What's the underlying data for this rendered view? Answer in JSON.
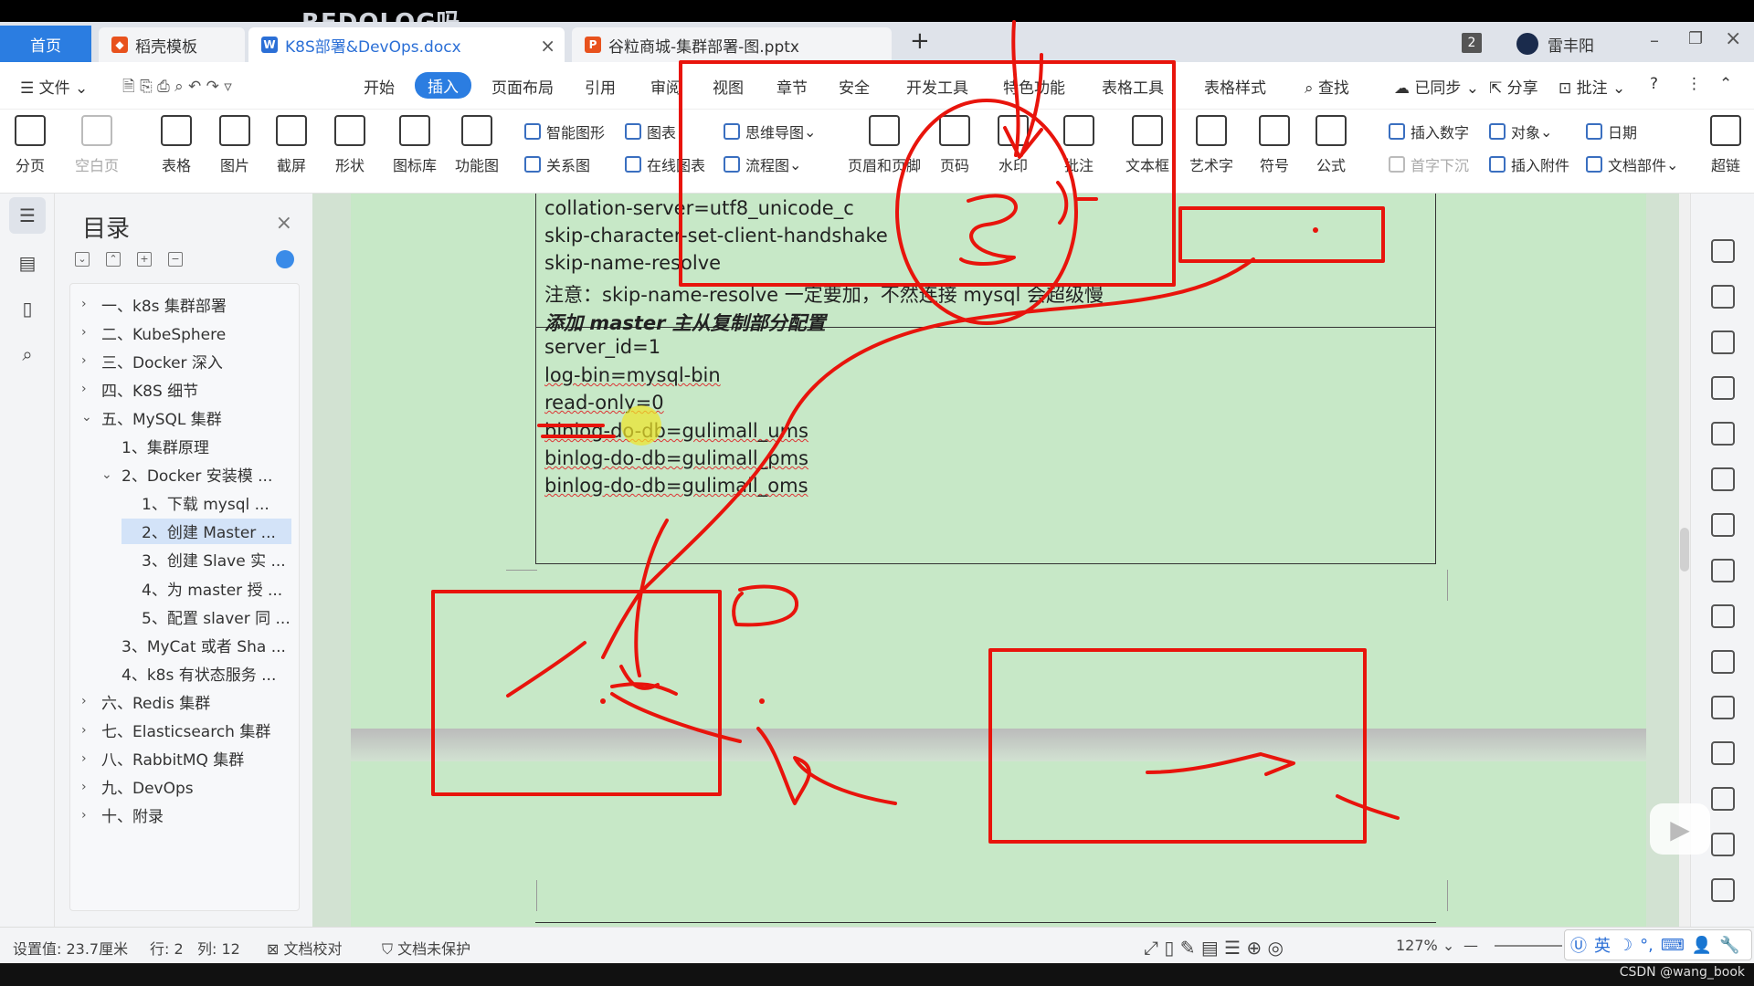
{
  "watermark": "REDOLOG吗",
  "tabs": {
    "home": "首页",
    "t1": "稻壳模板",
    "t2": "K8S部署&DevOps.docx",
    "t3": "谷粒商城-集群部署-图.pptx",
    "new": "+",
    "count": "2",
    "user": "雷丰阳"
  },
  "menu": {
    "file": "文件",
    "items": [
      "开始",
      "插入",
      "页面布局",
      "引用",
      "审阅",
      "视图",
      "章节",
      "安全",
      "开发工具",
      "特色功能",
      "表格工具",
      "表格样式"
    ],
    "active": "插入",
    "search": "查找",
    "sync": "已同步",
    "share": "分享",
    "comment": "批注"
  },
  "ribbon": {
    "page_break": "分页",
    "blank_page": "空白页",
    "table": "表格",
    "picture": "图片",
    "screenshot": "截屏",
    "shape": "形状",
    "icon_lib": "图标库",
    "func_chart": "功能图",
    "smart_shape": "智能图形",
    "chart": "图表",
    "mindmap": "思维导图",
    "relation": "关系图",
    "online_chart": "在线图表",
    "flowchart": "流程图",
    "header_footer": "页眉和页脚",
    "page_num": "页码",
    "watermark_btn": "水印",
    "comment_btn": "批注",
    "textbox": "文本框",
    "wordart": "艺术字",
    "symbol": "符号",
    "formula": "公式",
    "insert_num": "插入数字",
    "object": "对象",
    "date": "日期",
    "dropcap": "首字下沉",
    "attach": "插入附件",
    "doc_part": "文档部件",
    "hyperlink": "超链"
  },
  "toc": {
    "title": "目录",
    "items": [
      {
        "label": "一、k8s 集群部署",
        "level": 0,
        "arrow": "›"
      },
      {
        "label": "二、KubeSphere",
        "level": 0,
        "arrow": "›"
      },
      {
        "label": "三、Docker 深入",
        "level": 0,
        "arrow": "›"
      },
      {
        "label": "四、K8S 细节",
        "level": 0,
        "arrow": "›"
      },
      {
        "label": "五、MySQL 集群",
        "level": 0,
        "arrow": "⌄"
      },
      {
        "label": "1、集群原理",
        "level": 1,
        "arrow": ""
      },
      {
        "label": "2、Docker 安装模 ...",
        "level": 1,
        "arrow": "⌄"
      },
      {
        "label": "1、下载 mysql ...",
        "level": 2,
        "arrow": ""
      },
      {
        "label": "2、创建 Master ...",
        "level": 2,
        "arrow": "",
        "selected": true
      },
      {
        "label": "3、创建 Slave 实 ...",
        "level": 2,
        "arrow": ""
      },
      {
        "label": "4、为 master 授 ...",
        "level": 2,
        "arrow": ""
      },
      {
        "label": "5、配置 slaver 同 ...",
        "level": 2,
        "arrow": ""
      },
      {
        "label": "3、MyCat 或者 Sha ...",
        "level": 1,
        "arrow": ""
      },
      {
        "label": "4、k8s 有状态服务 ...",
        "level": 1,
        "arrow": ""
      },
      {
        "label": "六、Redis 集群",
        "level": 0,
        "arrow": "›"
      },
      {
        "label": "七、Elasticsearch 集群",
        "level": 0,
        "arrow": "›"
      },
      {
        "label": "八、RabbitMQ 集群",
        "level": 0,
        "arrow": "›"
      },
      {
        "label": "九、DevOps",
        "level": 0,
        "arrow": "›"
      },
      {
        "label": "十、附录",
        "level": 0,
        "arrow": "›"
      }
    ]
  },
  "doc": {
    "lines_top": [
      "collation-server=utf8_unicode_c",
      "skip-character-set-client-handshake",
      "skip-name-resolve",
      "注意：skip-name-resolve 一定要加，不然连接 mysql 会超级慢"
    ],
    "section_title": "添加 master 主从复制部分配置",
    "lines_bottom": [
      "server_id=1",
      "log-bin=mysql-bin",
      "read-only=0",
      "binlog-do-db=gulimall_ums",
      "binlog-do-db=gulimall_pms",
      "binlog-do-db=gulimall_oms"
    ]
  },
  "status": {
    "setting": "设置值: 23.7厘米",
    "row": "行: 2",
    "col": "列: 12",
    "proof": "文档校对",
    "protect": "文档未保护",
    "zoom": "127%",
    "ime_lang": "英"
  },
  "credit": "CSDN @wang_book",
  "colors": {
    "accent": "#2b7de1",
    "annotation": "#e8140c",
    "page": "#c7e8c7"
  }
}
